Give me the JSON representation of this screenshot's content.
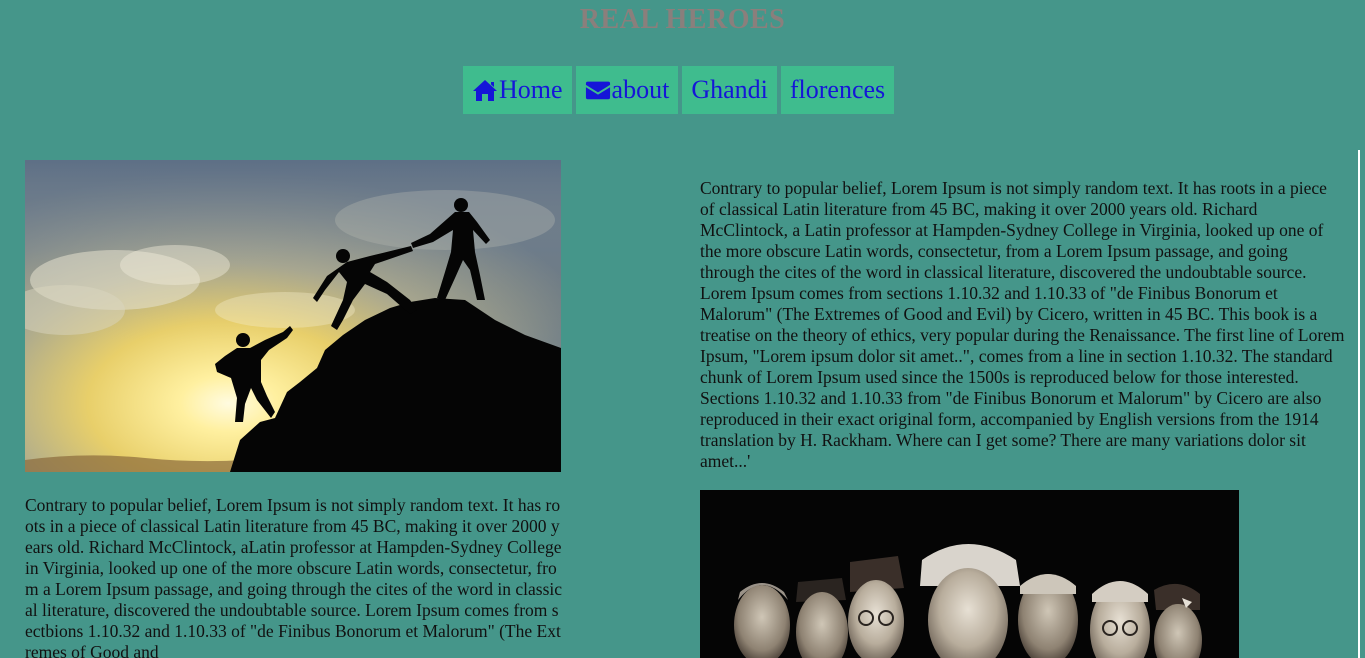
{
  "site": {
    "title": "REAL HEROES"
  },
  "nav": {
    "items": [
      {
        "label": "Home",
        "icon": "home-icon"
      },
      {
        "label": "about",
        "icon": "envelope-icon"
      },
      {
        "label": "Ghandi"
      },
      {
        "label": "florences"
      }
    ]
  },
  "content": {
    "left_text": "Contrary to popular belief, Lorem Ipsum is not simply random text. It has roots in a piece of classical Latin literature from 45 BC, making it over 2000 years old. Richard McClintock, aLatin professor at Hampden-Sydney College in Virginia, looked up one of the more obscure Latin words, consectetur, from a Lorem Ipsum passage, and going through the cites of the word in classical literature, discovered the undoubtable source. Lorem Ipsum comes from sectbions 1.10.32 and 1.10.33 of \"de Finibus Bonorum et Malorum\" (The Extremes of Good and",
    "right_text": "Contrary to popular belief, Lorem Ipsum is not simply random text. It has roots in a piece of classical Latin literature from 45 BC, making it over 2000 years old. Richard McClintock, a Latin professor at Hampden-Sydney College in Virginia, looked up one of the more obscure Latin words, consectetur, from a Lorem Ipsum passage, and going through the cites of the word in classical literature, discovered the undoubtable source. Lorem Ipsum comes from sections 1.10.32 and 1.10.33 of \"de Finibus Bonorum et Malorum\" (The Extremes of Good and Evil) by Cicero, written in 45 BC. This book is a treatise on the theory of ethics, very popular during the Renaissance. The first line of Lorem Ipsum, \"Lorem ipsum dolor sit amet..\", comes from a line in section 1.10.32. The standard chunk of Lorem Ipsum used since the 1500s is reproduced below for those interested. Sections 1.10.32 and 1.10.33 from \"de Finibus Bonorum et Malorum\" by Cicero are also reproduced in their exact original form, accompanied by English versions from the 1914 translation by H. Rackham. Where can I get some? There are many variations dolor sit amet...'"
  },
  "colors": {
    "background": "#45968a",
    "nav_bg": "#3fbc8e",
    "nav_text": "#1515d8",
    "title": "#8a7f7c"
  }
}
